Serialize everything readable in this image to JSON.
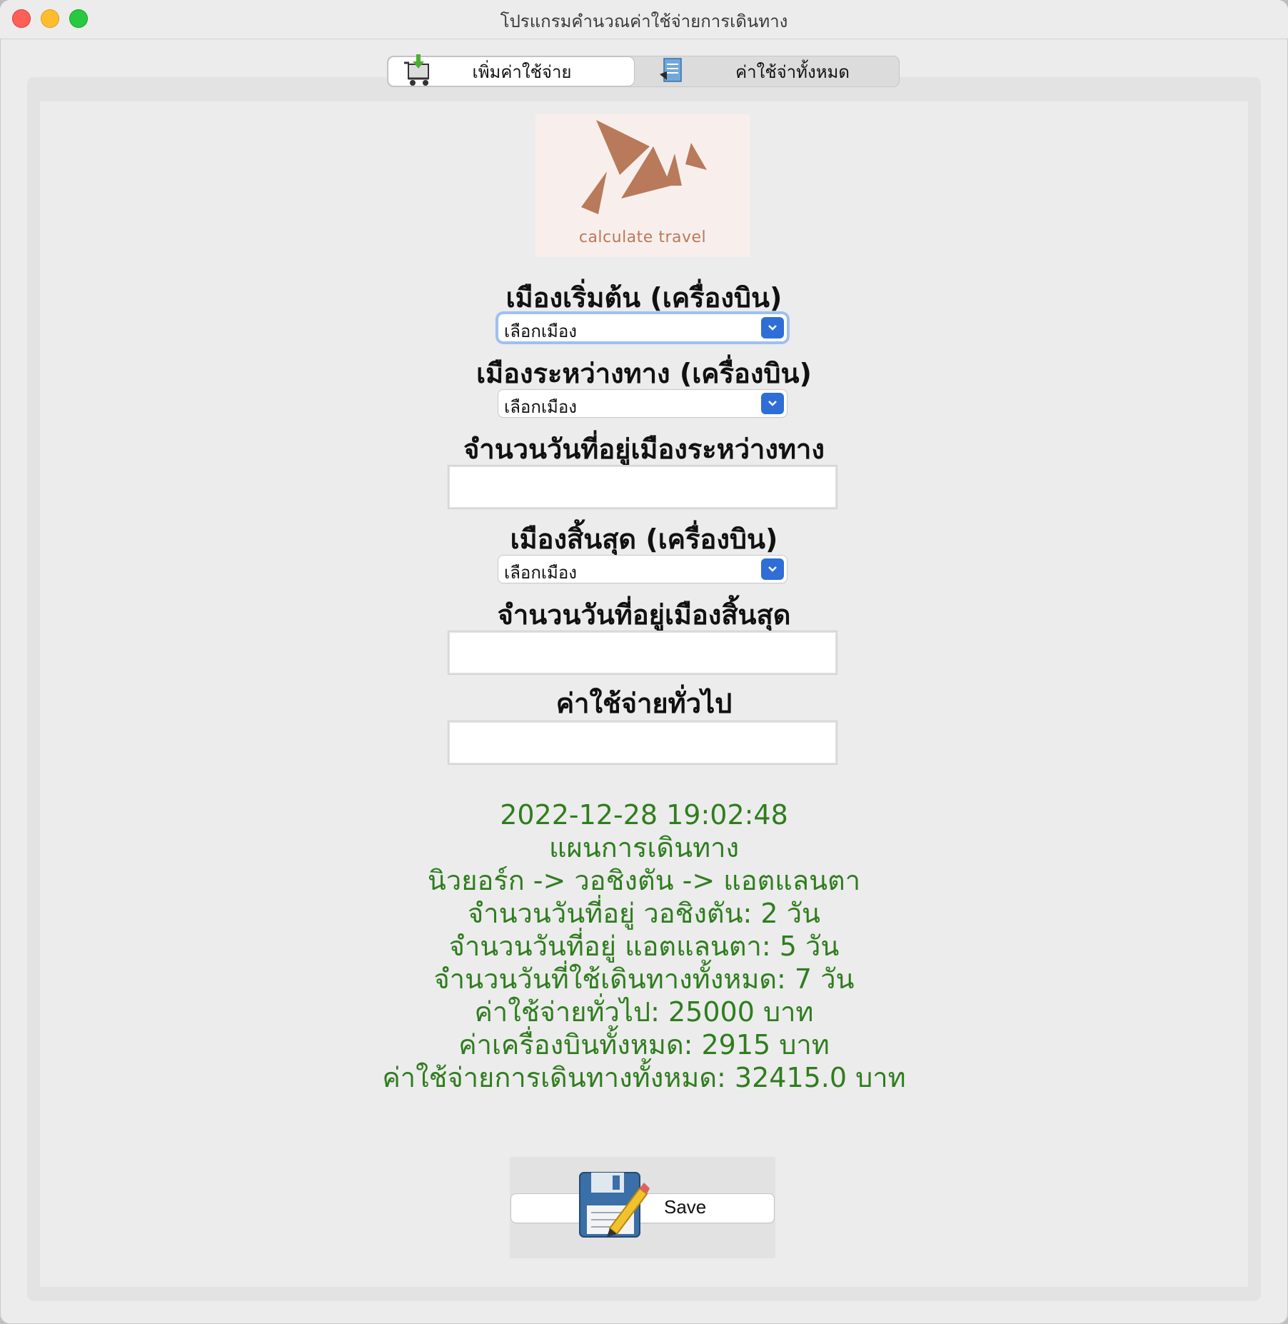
{
  "window": {
    "title": "โปรแกรมคำนวณค่าใช้จ่ายการเดินทาง"
  },
  "tabs": [
    {
      "label": "เพิ่มค่าใช้จ่าย",
      "icon": "cart-add-icon",
      "selected": true
    },
    {
      "label": "ค่าใช้จ่าทั้งหมด",
      "icon": "document-list-icon",
      "selected": false
    }
  ],
  "logo": {
    "text": "calculate travel",
    "color": "#b87a5a"
  },
  "form": {
    "start_city_label": "เมืองเริ่มต้น (เครื่องบิน)",
    "start_city_value": "เลือกเมือง",
    "transit_city_label": "เมืองระหว่างทาง (เครื่องบิน)",
    "transit_city_value": "เลือกเมือง",
    "transit_days_label": "จำนวนวันที่อยู่เมืองระหว่างทาง",
    "transit_days_value": "",
    "end_city_label": "เมืองสิ้นสุด (เครื่องบิน)",
    "end_city_value": "เลือกเมือง",
    "end_days_label": "จำนวนวันที่อยู่เมืองสิ้นสุด",
    "end_days_value": "",
    "general_expense_label": "ค่าใช้จ่ายทั่วไป",
    "general_expense_value": ""
  },
  "result": {
    "color": "#2f7d1e",
    "timestamp": "2022-12-28 19:02:48",
    "heading": "แผนการเดินทาง",
    "route": "นิวยอร์ก -> วอชิงตัน -> แอตแลนตา",
    "transit_days": "จำนวนวันที่อยู่ วอชิงตัน: 2 วัน",
    "end_days": "จำนวนวันที่อยู่ แอตแลนตา: 5 วัน",
    "total_days": "จำนวนวันที่ใช้เดินทางทั้งหมด: 7 วัน",
    "general_expense": "ค่าใช้จ่ายทั่วไป: 25000 บาท",
    "flight_cost": "ค่าเครื่องบินทั้งหมด: 2915 บาท",
    "total_cost": "ค่าใช้จ่ายการเดินทางทั้งหมด: 32415.0 บาท"
  },
  "save": {
    "label": "Save",
    "icon": "floppy-disk-edit-icon"
  },
  "colors": {
    "accent": "#2e6ed6",
    "close": "#fe5f57",
    "minimize": "#febc2e",
    "maximize": "#28c840"
  }
}
